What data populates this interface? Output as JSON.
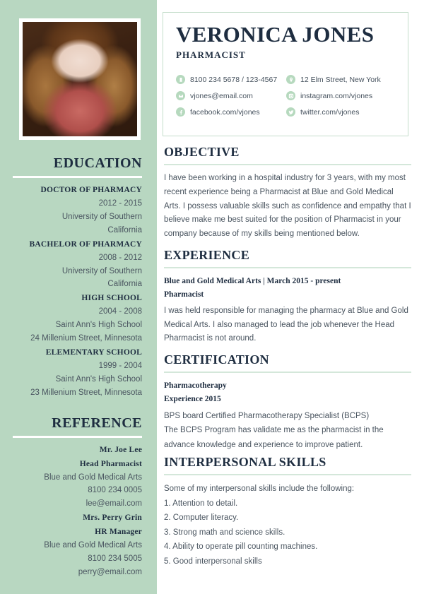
{
  "colors": {
    "sidebar_green": "#b8d7c1",
    "heading_navy": "#1e2d40",
    "body_gray": "#4a5560",
    "rule_green": "#d4e7da",
    "icon_green": "#b6d9be"
  },
  "header": {
    "name": "VERONICA JONES",
    "role": "PHARMACIST",
    "contacts": [
      {
        "icon": "phone-icon",
        "text": "8100 234 5678 / 123-4567"
      },
      {
        "icon": "location-pin-icon",
        "text": "12 Elm Street, New York"
      },
      {
        "icon": "envelope-icon",
        "text": "vjones@email.com"
      },
      {
        "icon": "instagram-icon",
        "text": "instagram.com/vjones"
      },
      {
        "icon": "facebook-icon",
        "text": "facebook.com/vjones"
      },
      {
        "icon": "twitter-icon",
        "text": "twitter.com/vjones"
      }
    ]
  },
  "sidebar": {
    "education": {
      "heading": "EDUCATION",
      "entries": [
        {
          "title": "DOCTOR OF PHARMACY",
          "lines": [
            "2012 - 2015",
            "University of Southern",
            "California"
          ]
        },
        {
          "title": "BACHELOR OF PHARMACY",
          "lines": [
            "2008 - 2012",
            "University of Southern",
            "California"
          ]
        },
        {
          "title": "HIGH SCHOOL",
          "lines": [
            "2004 - 2008",
            "Saint Ann's High School",
            "24 Millenium Street, Minnesota"
          ]
        },
        {
          "title": "ELEMENTARY SCHOOL",
          "lines": [
            "1999 - 2004",
            "Saint Ann's High School",
            "23 Millenium Street, Minnesota"
          ]
        }
      ]
    },
    "reference": {
      "heading": "REFERENCE",
      "entries": [
        {
          "name": "Mr. Joe Lee",
          "title": "Head Pharmacist",
          "lines": [
            "Blue and Gold Medical Arts",
            "8100 234 0005",
            "lee@email.com"
          ]
        },
        {
          "name": "Mrs. Perry Grin",
          "title": "HR Manager",
          "lines": [
            "Blue and Gold Medical Arts",
            "8100 234 5005",
            "perry@email.com"
          ]
        }
      ]
    }
  },
  "main": {
    "objective": {
      "heading": "OBJECTIVE",
      "text": "I have been working in a hospital industry for 3 years, with my most recent experience being a Pharmacist at Blue and Gold Medical Arts. I possess valuable skills such as confidence and empathy that I believe make me best suited for the position of Pharmacist in your company because of my skills being mentioned below."
    },
    "experience": {
      "heading": "EXPERIENCE",
      "employer_line": "Blue and Gold Medical Arts | March 2015 - present",
      "job_title": "Pharmacist",
      "description": "I was held responsible for managing the pharmacy at Blue and Gold Medical Arts. I also managed to lead the job whenever the Head Pharmacist is not around."
    },
    "certification": {
      "heading": "CERTIFICATION",
      "name": "Pharmacotherapy",
      "year_line": "Experience 2015",
      "lines": [
        "BPS board Certified Pharmacotherapy Specialist (BCPS)",
        "The BCPS Program has validate me as the pharmacist in the",
        "advance knowledge and experience to improve patient."
      ]
    },
    "skills": {
      "heading": "INTERPERSONAL SKILLS",
      "intro": "Some of my interpersonal skills include the following:",
      "items": [
        "1. Attention to detail.",
        "2. Computer literacy.",
        "3. Strong math and science skills.",
        "4. Ability to operate pill counting machines.",
        "5. Good interpersonal skills"
      ]
    }
  }
}
